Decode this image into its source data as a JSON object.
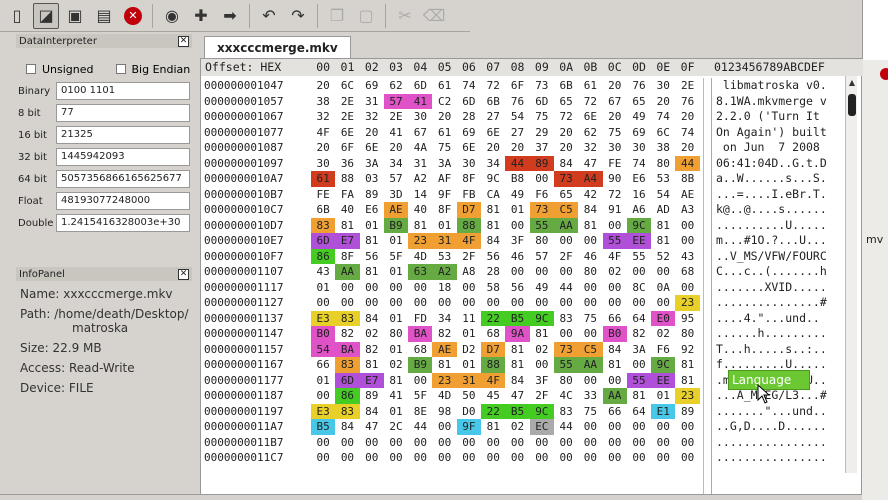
{
  "toolbar": {
    "icons": [
      "new-file-icon",
      "new-window-icon",
      "save-icon",
      "save-as-icon",
      "close-red-icon",
      "view-icon",
      "find-add-icon",
      "jump-icon",
      "undo-icon",
      "redo-icon",
      "copy-icon",
      "paste-icon",
      "cut-icon",
      "delete-icon"
    ]
  },
  "data_interpreter": {
    "title": "DataInterpreter",
    "unsigned_label": "Unsigned",
    "big_endian_label": "Big Endian",
    "fields": [
      {
        "label": "Binary",
        "value": "0100 1101"
      },
      {
        "label": "8 bit",
        "value": "77"
      },
      {
        "label": "16 bit",
        "value": "21325"
      },
      {
        "label": "32 bit",
        "value": "1445942093"
      },
      {
        "label": "64 bit",
        "value": "5057356866165625677"
      },
      {
        "label": "Float",
        "value": "48193077248000"
      },
      {
        "label": "Double",
        "value": "1.2415416328003e+30"
      }
    ]
  },
  "info_panel": {
    "title": "InfoPanel",
    "name": "Name: xxxcccmerge.mkv",
    "path1": "Path: /home/death/Desktop/",
    "path2": "matroska",
    "size": "Size: 22.9 MB",
    "access": "Access: Read-Write",
    "device": "Device: FILE"
  },
  "editor": {
    "tab_label": "xxxcccmerge.mkv",
    "header_offset": "Offset: HEX",
    "header_cols": [
      "00",
      "01",
      "02",
      "03",
      "04",
      "05",
      "06",
      "07",
      "08",
      "09",
      "0A",
      "0B",
      "0C",
      "0D",
      "0E",
      "0F"
    ],
    "header_ascii": "0123456789ABCDEF",
    "tooltip": "Language",
    "right_text": "mv",
    "rows": [
      {
        "off": "000000001047",
        "hex": [
          "20",
          "6C",
          "69",
          "62",
          "6D",
          "61",
          "74",
          "72",
          "6F",
          "73",
          "6B",
          "61",
          "20",
          "76",
          "30",
          "2E"
        ],
        "ascii": " libmatroska v0."
      },
      {
        "off": "000000001057",
        "hex": [
          "38",
          "2E",
          "31",
          "57",
          "41",
          "C2",
          "6D",
          "6B",
          "76",
          "6D",
          "65",
          "72",
          "67",
          "65",
          "20",
          "76"
        ],
        "ascii": "8.1WA.mkvmerge v"
      },
      {
        "off": "000000001067",
        "hex": [
          "32",
          "2E",
          "32",
          "2E",
          "30",
          "20",
          "28",
          "27",
          "54",
          "75",
          "72",
          "6E",
          "20",
          "49",
          "74",
          "20"
        ],
        "ascii": "2.2.0 ('Turn It "
      },
      {
        "off": "000000001077",
        "hex": [
          "4F",
          "6E",
          "20",
          "41",
          "67",
          "61",
          "69",
          "6E",
          "27",
          "29",
          "20",
          "62",
          "75",
          "69",
          "6C",
          "74"
        ],
        "ascii": "On Again') built"
      },
      {
        "off": "000000001087",
        "hex": [
          "20",
          "6F",
          "6E",
          "20",
          "4A",
          "75",
          "6E",
          "20",
          "20",
          "37",
          "20",
          "32",
          "30",
          "30",
          "38",
          "20"
        ],
        "ascii": " on Jun  7 2008 "
      },
      {
        "off": "000000001097",
        "hex": [
          "30",
          "36",
          "3A",
          "34",
          "31",
          "3A",
          "30",
          "34",
          "44",
          "89",
          "84",
          "47",
          "FE",
          "74",
          "80",
          "44"
        ],
        "ascii": "06:41:04D..G.t.D"
      },
      {
        "off": "0000000010A7",
        "hex": [
          "61",
          "88",
          "03",
          "57",
          "A2",
          "AF",
          "8F",
          "9C",
          "B8",
          "00",
          "73",
          "A4",
          "90",
          "E6",
          "53",
          "8B"
        ],
        "ascii": "a..W......s...S."
      },
      {
        "off": "0000000010B7",
        "hex": [
          "FE",
          "FA",
          "89",
          "3D",
          "14",
          "9F",
          "FB",
          "CA",
          "49",
          "F6",
          "65",
          "42",
          "72",
          "16",
          "54",
          "AE"
        ],
        "ascii": "...=....I.eBr.T."
      },
      {
        "off": "0000000010C7",
        "hex": [
          "6B",
          "40",
          "E6",
          "AE",
          "40",
          "8F",
          "D7",
          "81",
          "01",
          "73",
          "C5",
          "84",
          "91",
          "A6",
          "AD",
          "A3"
        ],
        "ascii": "k@..@....s......"
      },
      {
        "off": "0000000010D7",
        "hex": [
          "83",
          "81",
          "01",
          "B9",
          "81",
          "01",
          "88",
          "81",
          "00",
          "55",
          "AA",
          "81",
          "00",
          "9C",
          "81",
          "00"
        ],
        "ascii": "..........U....."
      },
      {
        "off": "0000000010E7",
        "hex": [
          "6D",
          "E7",
          "81",
          "01",
          "23",
          "31",
          "4F",
          "84",
          "3F",
          "80",
          "00",
          "00",
          "55",
          "EE",
          "81",
          "00"
        ],
        "ascii": "m...#1O.?...U..."
      },
      {
        "off": "0000000010F7",
        "hex": [
          "86",
          "8F",
          "56",
          "5F",
          "4D",
          "53",
          "2F",
          "56",
          "46",
          "57",
          "2F",
          "46",
          "4F",
          "55",
          "52",
          "43"
        ],
        "ascii": "..V_MS/VFW/FOURC"
      },
      {
        "off": "000000001107",
        "hex": [
          "43",
          "AA",
          "81",
          "01",
          "63",
          "A2",
          "A8",
          "28",
          "00",
          "00",
          "00",
          "80",
          "02",
          "00",
          "00",
          "68"
        ],
        "ascii": "C...c..(.......h"
      },
      {
        "off": "000000001117",
        "hex": [
          "01",
          "00",
          "00",
          "00",
          "00",
          "18",
          "00",
          "58",
          "56",
          "49",
          "44",
          "00",
          "00",
          "8C",
          "0A",
          "00"
        ],
        "ascii": ".......XVID....."
      },
      {
        "off": "000000001127",
        "hex": [
          "00",
          "00",
          "00",
          "00",
          "00",
          "00",
          "00",
          "00",
          "00",
          "00",
          "00",
          "00",
          "00",
          "00",
          "00",
          "23"
        ],
        "ascii": "...............#"
      },
      {
        "off": "000000001137",
        "hex": [
          "E3",
          "83",
          "84",
          "01",
          "FD",
          "34",
          "11",
          "22",
          "B5",
          "9C",
          "83",
          "75",
          "66",
          "64",
          "E0",
          "95"
        ],
        "ascii": "....4.\"...und.."
      },
      {
        "off": "000000001147",
        "hex": [
          "B0",
          "82",
          "02",
          "80",
          "BA",
          "82",
          "01",
          "68",
          "9A",
          "81",
          "00",
          "00",
          "B0",
          "82",
          "02",
          "80"
        ],
        "ascii": "......h........."
      },
      {
        "off": "000000001157",
        "hex": [
          "54",
          "BA",
          "82",
          "01",
          "68",
          "AE",
          "D2",
          "D7",
          "81",
          "02",
          "73",
          "C5",
          "84",
          "3A",
          "F6",
          "92"
        ],
        "ascii": "T...h.....s..:.."
      },
      {
        "off": "000000001167",
        "hex": [
          "66",
          "83",
          "81",
          "02",
          "B9",
          "81",
          "01",
          "88",
          "81",
          "00",
          "55",
          "AA",
          "81",
          "00",
          "9C",
          "81"
        ],
        "ascii": "f.........U....."
      },
      {
        "off": "000000001177",
        "hex": [
          "01",
          "6D",
          "E7",
          "81",
          "00",
          "23",
          "31",
          "4F",
          "84",
          "3F",
          "80",
          "00",
          "00",
          "55",
          "EE",
          "81"
        ],
        "ascii": ".m...#10.?...U.."
      },
      {
        "off": "000000001187",
        "hex": [
          "00",
          "86",
          "89",
          "41",
          "5F",
          "4D",
          "50",
          "45",
          "47",
          "2F",
          "4C",
          "33",
          "AA",
          "81",
          "01",
          "23"
        ],
        "ascii": "...A_MPEG/L3...#"
      },
      {
        "off": "000000001197",
        "hex": [
          "E3",
          "83",
          "84",
          "01",
          "8E",
          "98",
          "D0",
          "22",
          "B5",
          "9C",
          "83",
          "75",
          "66",
          "64",
          "E1",
          "89"
        ],
        "ascii": ".......\"...und.."
      },
      {
        "off": "0000000011A7",
        "hex": [
          "B5",
          "84",
          "47",
          "2C",
          "44",
          "00",
          "9F",
          "81",
          "02",
          "EC",
          "44",
          "00",
          "00",
          "00",
          "00",
          "00"
        ],
        "ascii": "..G,D....D......"
      },
      {
        "off": "0000000011B7",
        "hex": [
          "00",
          "00",
          "00",
          "00",
          "00",
          "00",
          "00",
          "00",
          "00",
          "00",
          "00",
          "00",
          "00",
          "00",
          "00",
          "00"
        ],
        "ascii": "................"
      },
      {
        "off": "0000000011C7",
        "hex": [
          "00",
          "00",
          "00",
          "00",
          "00",
          "00",
          "00",
          "00",
          "00",
          "00",
          "00",
          "00",
          "00",
          "00",
          "00",
          "00"
        ],
        "ascii": "................"
      }
    ]
  },
  "highlights": {
    "colors": {
      "pink": "#e052c8",
      "red": "#d23c1e",
      "orange": "#f0a032",
      "yellow": "#e8d028",
      "green": "#44cc22",
      "darkgreen": "#66aa44",
      "purple": "#b050d8",
      "cyan": "#48c8e8",
      "gray": "#aaaaaa"
    }
  }
}
